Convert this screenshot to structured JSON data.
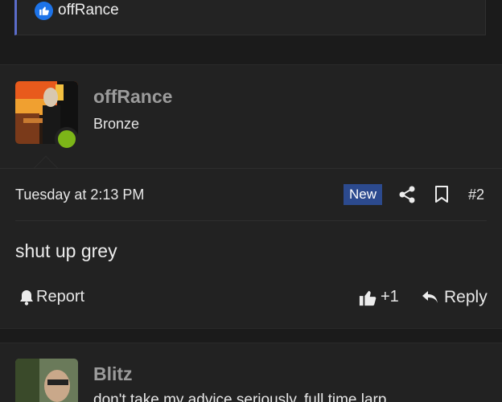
{
  "quote": {
    "reaction_icon": "thumbs-up-icon",
    "reaction_user": "offRance",
    "accent_color": "#5b6cc9"
  },
  "post": {
    "username": "offRance",
    "user_title": "Bronze",
    "online_status_color": "#7cb518",
    "date": "Tuesday at 2:13 PM",
    "badge": "New",
    "badge_color": "#2c4a8e",
    "post_number": "#2",
    "message": "shut up grey",
    "actions": {
      "report_label": "Report",
      "like_count": "+1",
      "reply_label": "Reply"
    }
  },
  "next_post": {
    "username": "Blitz",
    "preview": "don't take my advice seriously. full time larp"
  }
}
